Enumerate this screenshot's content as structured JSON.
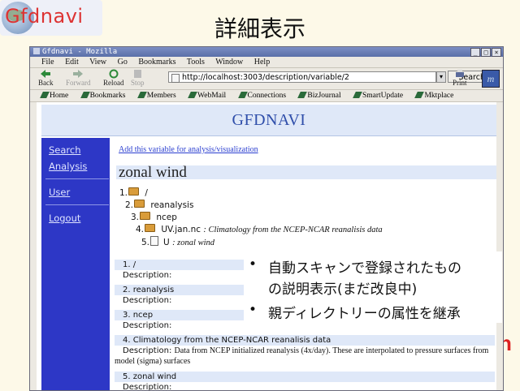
{
  "slide": {
    "logo_text": "Gfdnavi",
    "title": "詳細表示",
    "red_fragment": "n",
    "bullets": [
      {
        "line1": "自動スキャンで登録されたもの",
        "line2": "の説明表示(まだ改良中)"
      },
      {
        "line1": "親ディレクトリーの属性を継承"
      }
    ]
  },
  "browser": {
    "window_title": "Gfdnavi - Mozilla",
    "menu": [
      "File",
      "Edit",
      "View",
      "Go",
      "Bookmarks",
      "Tools",
      "Window",
      "Help"
    ],
    "toolbar": {
      "back": "Back",
      "forward": "Forward",
      "reload": "Reload",
      "stop": "Stop",
      "search": "Search",
      "print": "Print"
    },
    "url": "http://localhost:3003/description/variable/2",
    "bookmarks": [
      "Home",
      "Bookmarks",
      "Members",
      "WebMail",
      "Connections",
      "BizJournal",
      "SmartUpdate",
      "Mktplace"
    ]
  },
  "page": {
    "banner": "GFDNAVI",
    "sidebar": [
      "Search",
      "Analysis",
      "User",
      "Logout"
    ],
    "add_link": "Add this variable for analysis/visualization",
    "variable_name": "zonal wind",
    "tree": [
      {
        "num": "1.",
        "name": "/",
        "note": ""
      },
      {
        "num": "2.",
        "name": "reanalysis",
        "note": ""
      },
      {
        "num": "3.",
        "name": "ncep",
        "note": ""
      },
      {
        "num": "4.",
        "name": "UV.jan.nc",
        "note": ":   Climatology from the NCEP-NCAR reanalisis data"
      },
      {
        "num": "5.",
        "name": "U",
        "note": ":   zonal wind"
      }
    ],
    "descriptions": [
      {
        "header": "1. /",
        "body": "Description:"
      },
      {
        "header": "2. reanalysis",
        "body": "Description:"
      },
      {
        "header": "3. ncep",
        "body": "Description:"
      },
      {
        "header": "4. Climatology from the NCEP-NCAR reanalisis data",
        "label": "Description:",
        "text": "Data from NCEP initialized reanalysis (4x/day). These are interpolated to pressure surfaces from model (sigma) surfaces"
      },
      {
        "header": "5. zonal wind",
        "body": "Description:"
      }
    ]
  },
  "colors": {
    "sidebar": "#2d37c6",
    "banner_bg": "#dfe8f8",
    "banner_text": "#2f4eaa",
    "link": "#2a3ed0",
    "title_red": "#dd3333"
  }
}
